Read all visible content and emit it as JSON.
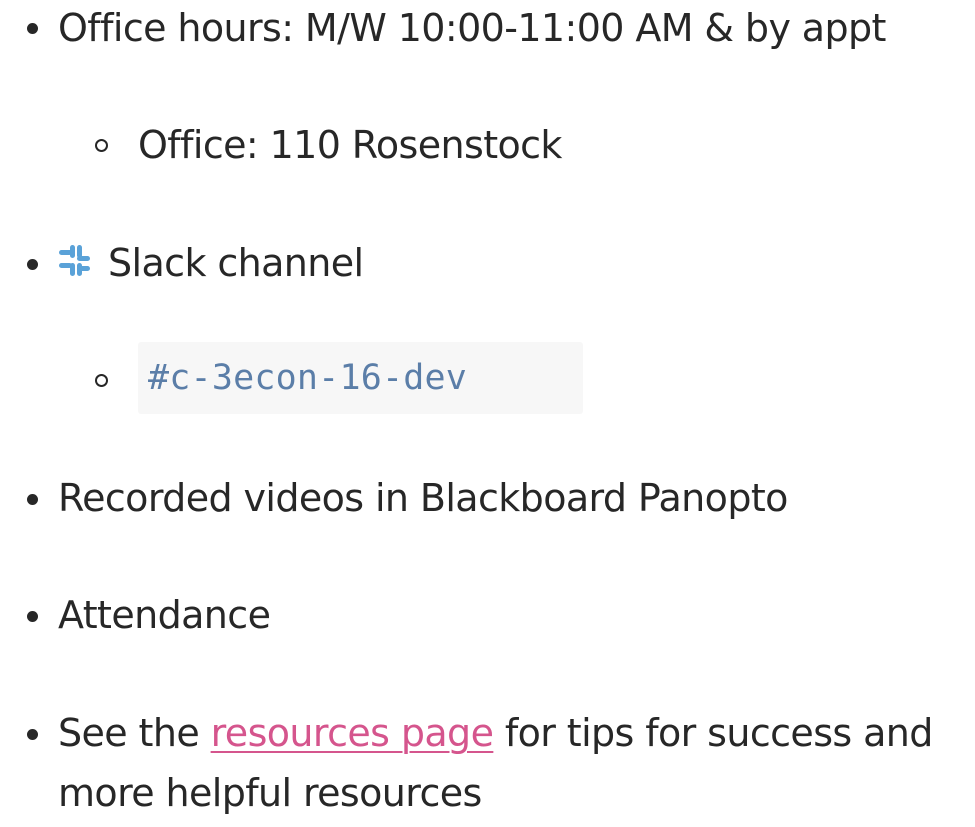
{
  "list": {
    "office_hours": "Office hours: M/W 10:00-11:00 AM & by appt",
    "office": "Office: 110 Rosenstock",
    "slack": "Slack channel",
    "slack_channel_code": "#c-3econ-16-dev",
    "recorded": "Recorded videos in Blackboard Panopto",
    "attendance": "Attendance",
    "resources_before": "See the ",
    "resources_link": "resources page",
    "resources_after": " for tips for success and",
    "resources_line2": "more helpful resources"
  },
  "colors": {
    "text": "#272727",
    "link": "#d5558d",
    "code_text": "#5b7ea8",
    "code_bg": "#f7f7f7",
    "slack_icon": "#5aa2d8"
  },
  "icons": {
    "slack": "slack-icon"
  }
}
